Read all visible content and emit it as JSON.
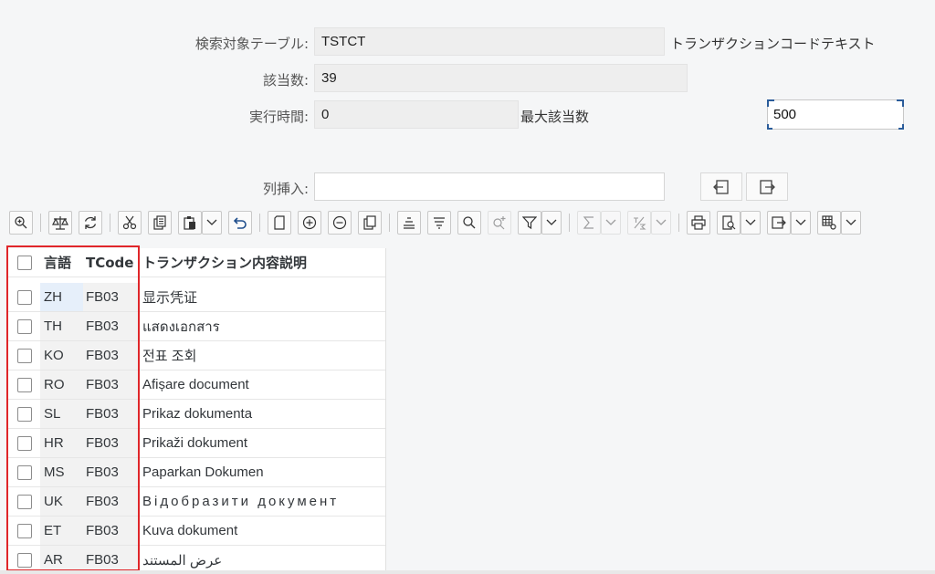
{
  "form": {
    "table_label": "検索対象テーブル:",
    "table_value": "TSTCT",
    "table_desc": "トランザクションコードテキスト",
    "count_label": "該当数:",
    "count_value": "39",
    "time_label": "実行時間:",
    "time_value": "0",
    "max_label": "最大該当数",
    "max_value": "500",
    "insert_label": "列挿入:",
    "insert_value": ""
  },
  "toolbar": {
    "icons": [
      "zoom-icon",
      "balance-icon",
      "refresh-icon",
      "cut-icon",
      "copy-icon",
      "paste-icon",
      "undo-icon",
      "new-page-icon",
      "add-row-icon",
      "remove-row-icon",
      "copy-row-icon",
      "sort-asc-icon",
      "sort-desc-icon",
      "find-icon",
      "find-next-icon",
      "filter-icon",
      "sum-icon",
      "subtotal-icon",
      "print-icon",
      "view-icon",
      "export-icon",
      "layout-icon"
    ]
  },
  "grid": {
    "columns": [
      "言語",
      "TCode",
      "トランザクション内容説明"
    ],
    "rows": [
      {
        "lang": "ZH",
        "code": "FB03",
        "text": "显示凭证"
      },
      {
        "lang": "TH",
        "code": "FB03",
        "text": "แสดงเอกสาร"
      },
      {
        "lang": "KO",
        "code": "FB03",
        "text": "전표 조회"
      },
      {
        "lang": "RO",
        "code": "FB03",
        "text": "Afișare document"
      },
      {
        "lang": "SL",
        "code": "FB03",
        "text": "Prikaz dokumenta"
      },
      {
        "lang": "HR",
        "code": "FB03",
        "text": "Prikaži dokument"
      },
      {
        "lang": "MS",
        "code": "FB03",
        "text": "Paparkan Dokumen"
      },
      {
        "lang": "UK",
        "code": "FB03",
        "text": "Відобразити документ"
      },
      {
        "lang": "ET",
        "code": "FB03",
        "text": "Kuva dokument"
      },
      {
        "lang": "AR",
        "code": "FB03",
        "text": "عرض المستند"
      }
    ]
  },
  "colors": {
    "highlight": "#e0262a",
    "selected_cell": "#e6effa"
  }
}
